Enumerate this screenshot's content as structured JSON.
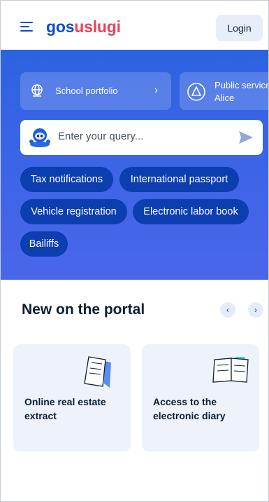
{
  "header": {
    "logo_part1": "gos",
    "logo_part2": "uslugi",
    "login_label": "Login"
  },
  "hero": {
    "school_portfolio_label": "School portfolio",
    "public_services_title": "Public services",
    "public_services_subtitle": "Alice",
    "search_placeholder": "Enter your query...",
    "tags": [
      "Tax notifications",
      "International passport",
      "Vehicle registration",
      "Electronic labor book",
      "Bailiffs"
    ]
  },
  "section": {
    "title": "New on the portal",
    "prev_icon": "chevron-left-icon",
    "next_icon": "chevron-right-icon",
    "cards": [
      {
        "label": "Online real estate extract",
        "icon": "document-icon"
      },
      {
        "label": "Access to the electronic diary",
        "icon": "diary-icon"
      }
    ]
  },
  "colors": {
    "brand_blue": "#0d4cd3",
    "brand_red": "#ee3f58",
    "hero_bg": "#3b64e6",
    "tag_bg": "#0d3eb0",
    "card_bg": "#edf2fb"
  }
}
